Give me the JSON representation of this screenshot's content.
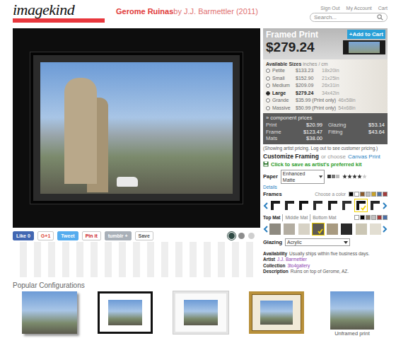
{
  "logo": "imagekind",
  "title": {
    "name": "Gerome Ruinas",
    "byline": "by J.J. Barmettler (2011)"
  },
  "top_links": [
    "Sign Out",
    "My Account",
    "Cart"
  ],
  "search": {
    "placeholder": "Search..."
  },
  "social_buttons": [
    {
      "label": "Like 0",
      "kind": "filled",
      "color": "#4267b2"
    },
    {
      "label": "G+1",
      "kind": "outline",
      "color": "#dd4b39"
    },
    {
      "label": "Tweet",
      "kind": "filled",
      "color": "#55acee"
    },
    {
      "label": "Pin it",
      "kind": "outline",
      "color": "#cb2027"
    },
    {
      "label": "tumblr +",
      "kind": "filled",
      "color": "#a9b0b8"
    },
    {
      "label": "Save",
      "kind": "outline",
      "color": "#555555"
    }
  ],
  "wall_colors": [
    {
      "color": "#2f4a44",
      "selected": true
    },
    {
      "color": "#8c8c8c",
      "selected": false
    },
    {
      "color": "#cfcfcf",
      "selected": false
    }
  ],
  "product": {
    "type": "Framed Print",
    "price": "$279.24",
    "add_to_cart": "+Add to Cart"
  },
  "sizes": {
    "label": "Available Sizes",
    "units": "inches / cm",
    "options": [
      {
        "name": "Petite",
        "price": "$133.23",
        "dims": "18x20in",
        "selected": false
      },
      {
        "name": "Small",
        "price": "$152.90",
        "dims": "21x25in",
        "selected": false
      },
      {
        "name": "Medium",
        "price": "$209.09",
        "dims": "26x31in",
        "selected": false
      },
      {
        "name": "Large",
        "price": "$279.24",
        "dims": "34x42in",
        "selected": true
      },
      {
        "name": "Grande",
        "price": "$35.99 (Print only)",
        "dims": "46x58in",
        "selected": false
      },
      {
        "name": "Massive",
        "price": "$50.99 (Print only)",
        "dims": "54x68in",
        "selected": false
      }
    ]
  },
  "component_prices": {
    "toggle": "» component prices",
    "items": [
      {
        "label": "Print",
        "value": "$20.99"
      },
      {
        "label": "Glazing",
        "value": "$53.14"
      },
      {
        "label": "Frame",
        "value": "$123.47"
      },
      {
        "label": "Fitting",
        "value": "$43.64"
      },
      {
        "label": "Mats",
        "value": "$38.00"
      }
    ]
  },
  "pricing_note": "(Showing artist pricing. Log out to see customer pricing.)",
  "customize": {
    "title": "Customize Framing",
    "or": "or choose",
    "link": "Canvas Print"
  },
  "save_kit": "Click to save as artist's preferred kit",
  "paper": {
    "label": "Paper",
    "value": "Enhanced Matte",
    "details": "Details",
    "stars": 4
  },
  "frames": {
    "label": "Frames",
    "choose": "Choose a color",
    "colors": [
      "#000000",
      "#ffffff",
      "#8b5a2b",
      "#c0c0c0",
      "#c9a227",
      "#4a6fa5",
      "#a33a3a"
    ],
    "items": [
      {
        "color": "#1a1a1a",
        "selected": false
      },
      {
        "color": "#222222",
        "selected": false
      },
      {
        "color": "#111111",
        "selected": false
      },
      {
        "color": "#2a2a2a",
        "selected": false
      },
      {
        "color": "#1c1c1c",
        "selected": false
      },
      {
        "color": "#303030",
        "selected": false
      },
      {
        "color": "#151515",
        "selected": true
      },
      {
        "color": "#262626",
        "selected": false
      }
    ]
  },
  "mats": {
    "tabs": [
      {
        "label": "Top Mat",
        "selected": true
      },
      {
        "label": "Middle Mat",
        "selected": false
      },
      {
        "label": "Bottom Mat",
        "selected": false
      }
    ],
    "colors": [
      "#ffffff",
      "#000000",
      "#8b7d6b",
      "#c0c0c0",
      "#a33a3a",
      "#4a6fa5"
    ],
    "swatches": [
      {
        "color": "#8e8a80",
        "selected": false
      },
      {
        "color": "#b3ada1",
        "selected": false
      },
      {
        "color": "#d7d2c5",
        "selected": false
      },
      {
        "color": "#5e5a52",
        "selected": true
      },
      {
        "color": "#a89a80",
        "selected": false
      },
      {
        "color": "#2a2a2a",
        "selected": false
      },
      {
        "color": "#cbc6b4",
        "selected": false
      },
      {
        "color": "#e2ded2",
        "selected": false
      }
    ]
  },
  "glazing": {
    "label": "Glazing",
    "value": "Acrylic"
  },
  "info": [
    {
      "label": "Availability",
      "value": "Usually ships within five business days.",
      "link": false
    },
    {
      "label": "Artist",
      "value": "J.J. Barmettler",
      "link": true
    },
    {
      "label": "Collection",
      "value": "3to4gallery",
      "link": true
    },
    {
      "label": "Description",
      "value": "Ruins on top of Gerome, AZ.",
      "link": false
    }
  ],
  "popular": {
    "title": "Popular Configurations",
    "items": [
      {
        "kind": "canvas",
        "caption": ""
      },
      {
        "kind": "black-frame",
        "caption": ""
      },
      {
        "kind": "white-frame",
        "caption": ""
      },
      {
        "kind": "gold-frame",
        "caption": ""
      },
      {
        "kind": "unframed",
        "caption": "Unframed print"
      }
    ]
  }
}
